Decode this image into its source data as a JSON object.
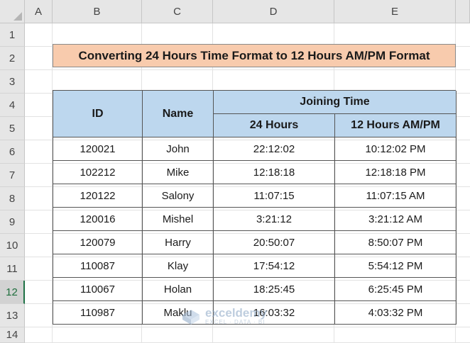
{
  "columns": [
    "A",
    "B",
    "C",
    "D",
    "E"
  ],
  "rows": [
    "1",
    "2",
    "3",
    "4",
    "5",
    "6",
    "7",
    "8",
    "9",
    "10",
    "11",
    "12",
    "13",
    "14"
  ],
  "selected_row": "12",
  "title": "Converting 24 Hours Time Format to 12 Hours AM/PM Format",
  "table": {
    "headers": {
      "id": "ID",
      "name": "Name",
      "joining_time": "Joining Time",
      "h24": "24 Hours",
      "h12": "12 Hours AM/PM"
    },
    "records": [
      {
        "id": "120021",
        "name": "John",
        "h24": "22:12:02",
        "h12": "10:12:02 PM"
      },
      {
        "id": "102212",
        "name": "Mike",
        "h24": "12:18:18",
        "h12": "12:18:18 PM"
      },
      {
        "id": "120122",
        "name": "Salony",
        "h24": "11:07:15",
        "h12": "11:07:15 AM"
      },
      {
        "id": "120016",
        "name": "Mishel",
        "h24": "3:21:12",
        "h12": "3:21:12 AM"
      },
      {
        "id": "120079",
        "name": "Harry",
        "h24": "20:50:07",
        "h12": "8:50:07 PM"
      },
      {
        "id": "110087",
        "name": "Klay",
        "h24": "17:54:12",
        "h12": "5:54:12 PM"
      },
      {
        "id": "110067",
        "name": "Holan",
        "h24": "18:25:45",
        "h12": "6:25:45 PM"
      },
      {
        "id": "110987",
        "name": "Maklu",
        "h24": "16:03:32",
        "h12": "4:03:32 PM"
      }
    ]
  },
  "watermark": {
    "name": "exceldemy",
    "tagline": "EXCEL · DATA · BI",
    "icon": "exceldemy-logo-icon"
  },
  "colors": {
    "title_fill": "#f8cbad",
    "header_fill": "#bdd7ee",
    "selected_row_accent": "#1e7145"
  }
}
